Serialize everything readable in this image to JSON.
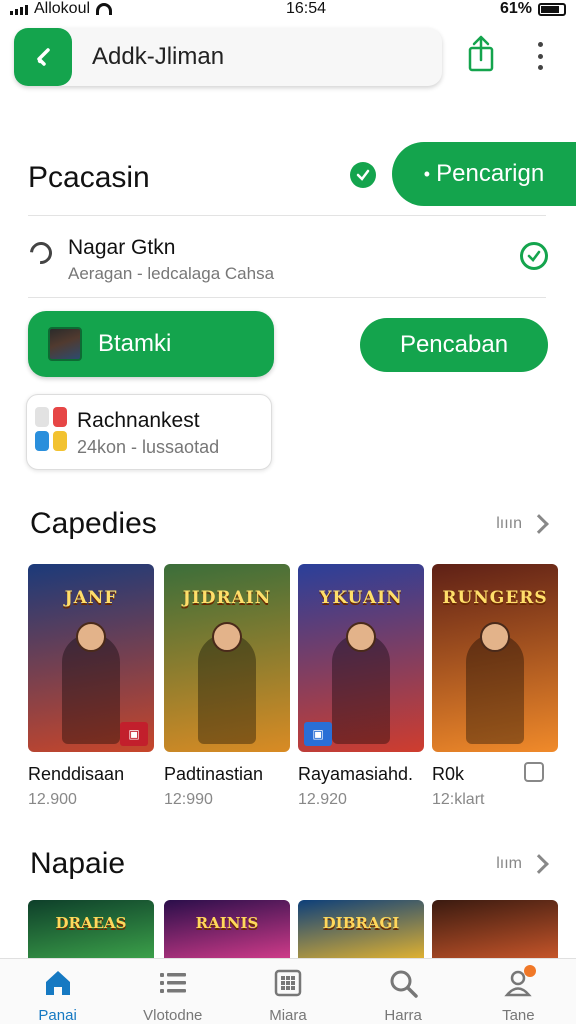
{
  "status_bar": {
    "carrier": "Allokoul",
    "time": "16:54",
    "battery": "61%"
  },
  "url_bar": {
    "text": "Addk-Jliman"
  },
  "main": {
    "title": "Pcacasin",
    "primary_button": "Pencarign",
    "list_row": {
      "title": "Nagar Gtkn",
      "subtitle": "Aeragan - ledcalaga Cahsa"
    },
    "green_button": "Btamki",
    "outline_button": "Pencaban",
    "info_card": {
      "title": "Rachnankest",
      "subtitle": "24kon - lussaotad",
      "icon_colors": [
        "#e2e2e2",
        "#e64646",
        "#2a8fdc",
        "#f2c230"
      ]
    }
  },
  "section1": {
    "title": "Capedies",
    "more": "lııın",
    "games": [
      {
        "name": "Renddisaan",
        "meta": "12.900",
        "logo": "JANF",
        "colors": [
          "#1b3a7a",
          "#c8462a"
        ],
        "badge": "red"
      },
      {
        "name": "Padtinastian",
        "meta": "12:990",
        "logo": "JIDRAIN",
        "colors": [
          "#3b6e3a",
          "#d98b24"
        ],
        "badge": "none"
      },
      {
        "name": "Rayamasiahd.",
        "meta": "12.920",
        "logo": "YKUAIN",
        "colors": [
          "#2a3f9a",
          "#cf3d2e"
        ],
        "badge": "blue"
      },
      {
        "name": "R0k",
        "meta": "12:klart",
        "logo": "RUNGERS",
        "colors": [
          "#5e2016",
          "#f08a2a"
        ],
        "badge": "none"
      }
    ]
  },
  "section2": {
    "title": "Napaie",
    "more": "lıım",
    "games": [
      {
        "logo": "DRAEAS",
        "colors": [
          "#0e3f2a",
          "#3ca24a"
        ]
      },
      {
        "logo": "RAINIS",
        "colors": [
          "#2a0e4a",
          "#d23c8a"
        ]
      },
      {
        "logo": "DIBRAGI",
        "colors": [
          "#0d3f7a",
          "#e3b330"
        ]
      },
      {
        "logo": "",
        "colors": [
          "#3a1a10",
          "#c8562a"
        ]
      }
    ]
  },
  "bottom_nav": [
    {
      "label": "Panai",
      "icon": "home-icon",
      "active": true
    },
    {
      "label": "Vlotodne",
      "icon": "list-icon",
      "active": false
    },
    {
      "label": "Miara",
      "icon": "grid-icon",
      "active": false
    },
    {
      "label": "Harra",
      "icon": "search-icon",
      "active": false
    },
    {
      "label": "Tane",
      "icon": "profile-icon",
      "active": false
    }
  ],
  "colors": {
    "accent": "#14a44d",
    "nav_active": "#1679c2"
  }
}
